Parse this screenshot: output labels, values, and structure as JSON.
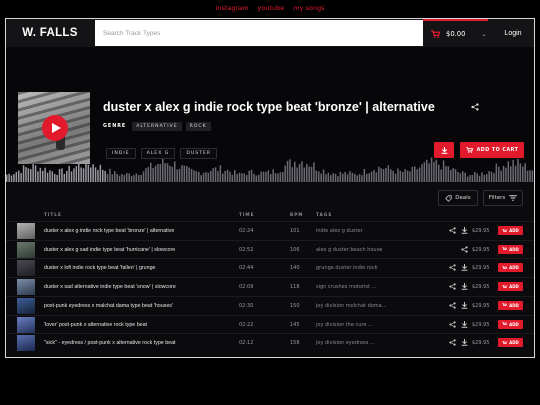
{
  "top_links": [
    "instagram",
    "youtube",
    "my songs"
  ],
  "header": {
    "logo": "W. FALLS",
    "search_placeholder": "Search Track Types",
    "cart_total": "$0.00",
    "login": "Login"
  },
  "hero": {
    "title": "duster x alex g indie rock type beat 'bronze' | alternative",
    "genre_label": "GENRE",
    "genres": [
      "ALTERNATIVE",
      "ROCK"
    ],
    "tags": [
      "INDIE",
      "ALEX G",
      "DUSTER"
    ],
    "add_to_cart": "ADD TO CART"
  },
  "toolbar": {
    "deals": "Deals",
    "filters": "Filters"
  },
  "table": {
    "headers": {
      "title": "TITLE",
      "time": "TIME",
      "bpm": "BPM",
      "tags": "TAGS"
    },
    "rows": [
      {
        "title": "duster x alex g indie rock type beat 'bronze' | alternative",
        "time": "02:24",
        "bpm": "101",
        "tags": "indie   alex g   duster",
        "price": "$29.95",
        "add": "ADD",
        "has_download": true
      },
      {
        "title": "duster x alex g sad indie type beat 'hurricane' | slowcore",
        "time": "02:52",
        "bpm": "106",
        "tags": "alex g   duster   beach house",
        "price": "$29.95",
        "add": "ADD",
        "has_download": false
      },
      {
        "title": "duster x lofi indie rock type beat 'fallen' | grunge",
        "time": "02:44",
        "bpm": "140",
        "tags": "grunge   duster   indie rock",
        "price": "$29.95",
        "add": "ADD",
        "has_download": true
      },
      {
        "title": "duster x sad alternative indie type beat 'snow' | slowcore",
        "time": "02:09",
        "bpm": "118",
        "tags": "sign crushes motorist ...",
        "price": "$29.95",
        "add": "ADD",
        "has_download": true
      },
      {
        "title": "post-punk eyedress x malchat dama type beat 'houses'",
        "time": "02:30",
        "bpm": "150",
        "tags": "joy division   molchat doma...",
        "price": "$29.95",
        "add": "ADD",
        "has_download": true
      },
      {
        "title": "'lover' post-punk x alternative rock type beat",
        "time": "02:22",
        "bpm": "145",
        "tags": "joy division   the cure ...",
        "price": "$29.95",
        "add": "ADD",
        "has_download": true
      },
      {
        "title": "\"sick\" - eyedress / post-punk x alternative rock type beat",
        "time": "02:12",
        "bpm": "158",
        "tags": "joy division   eyedress ...",
        "price": "$29.95",
        "add": "ADD",
        "has_download": true
      }
    ]
  },
  "colors": {
    "accent": "#e21b2c",
    "background": "#0b0b0e"
  }
}
